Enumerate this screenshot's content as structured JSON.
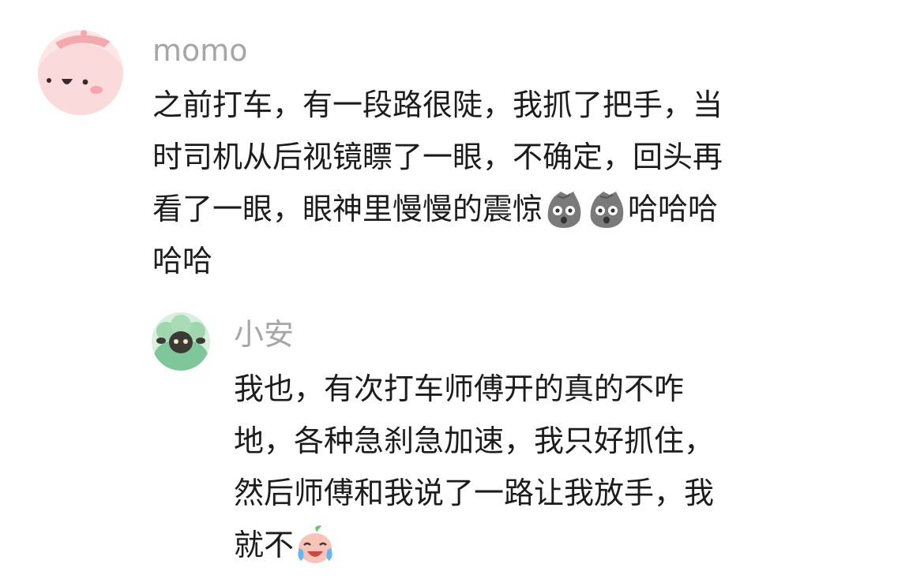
{
  "comments": {
    "top": {
      "username": "momo",
      "text_parts": [
        "之前打车，有一段路很陡，我抓了把手，当",
        "时司机从后视镜瞟了一眼，不确定，回头再",
        "看了一眼，眼神里慢慢的震惊",
        "哈哈哈",
        "哈哈"
      ],
      "emojis": [
        "shocked-rock-emoji",
        "shocked-rock-emoji"
      ]
    },
    "reply": {
      "username": "小安",
      "text_parts": [
        "我也，有次打车师傅开的真的不咋",
        "地，各种急刹急加速，我只好抓住，",
        "然后师傅和我说了一路让我放手，我",
        "就不"
      ],
      "emojis": [
        "crying-laughing-peach-emoji"
      ]
    }
  },
  "colors": {
    "username": "#a6a6a6",
    "text": "#1c1c1c",
    "background": "#ffffff",
    "avatar_pink": "#f9d4d6",
    "avatar_green": "#7fc79a"
  }
}
